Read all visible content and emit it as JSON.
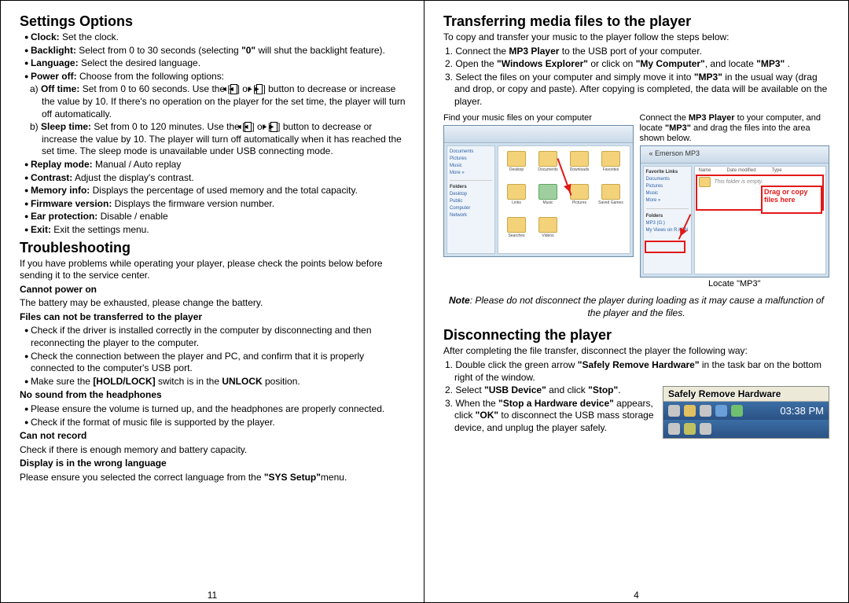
{
  "left": {
    "h_settings": "Settings Options",
    "clock": {
      "b": "Clock:",
      "t": " Set the clock."
    },
    "backlight": {
      "b": "Backlight:",
      "t1": " Select from 0 to 30 seconds (selecting ",
      "q0": "\"0\"",
      "t2": " will shut the backlight feature)."
    },
    "language": {
      "b": "Language:",
      "t": " Select the desired language."
    },
    "poweroff": {
      "b": "Power off:",
      "t": " Choose from the following options:"
    },
    "offtime": {
      "pre": "a) ",
      "b": "Off time:",
      "t1": " Set from 0 to 60 seconds.  Use the [",
      "t2": "] or [",
      "t3": "] button to decrease or increase the value by 10.  If there's no operation on the player for the set time, the player will turn off automatically."
    },
    "sleeptime": {
      "pre": "b) ",
      "b": "Sleep time:",
      "t1": " Set from 0 to 120 minutes. Use the [",
      "t2": "] or [",
      "t3": "] button to decrease or increase the value by 10. The player will turn off automatically when it has reached the set time. The sleep mode is unavailable under USB connecting mode."
    },
    "replay": {
      "b": "Replay mode:",
      "t": " Manual / Auto replay"
    },
    "contrast": {
      "b": "Contrast:",
      "t": " Adjust the display's contrast."
    },
    "memory": {
      "b": "Memory info:",
      "t": " Displays the percentage of used memory and the total capacity."
    },
    "fw": {
      "b": "Firmware version:",
      "t": " Displays the firmware version number."
    },
    "ear": {
      "b": "Ear protection:",
      "t": " Disable / enable"
    },
    "exit": {
      "b": "Exit:",
      "t": " Exit the settings menu."
    },
    "h_trouble": "Troubleshooting",
    "trouble_intro": "If you have problems while operating your player, please check the points below before sending it to the service center.",
    "t1_h": "Cannot power on",
    "t1_t": "The battery may be exhausted, please change the battery.",
    "t2_h": "Files can not be transferred to the player",
    "t2_b1": "Check if the driver is installed correctly in the computer by disconnecting and then reconnecting the player to the computer.",
    "t2_b2": "Check the connection between the player and PC, and confirm that it is properly connected to the computer's USB port.",
    "t2_b3a": "Make sure the ",
    "t2_b3b": "[HOLD/LOCK]",
    "t2_b3c": " switch is in the ",
    "t2_b3d": "UNLOCK",
    "t2_b3e": " position.",
    "t3_h": "No sound from the headphones",
    "t3_b1": "Please ensure the volume is turned up, and the headphones are properly connected.",
    "t3_b2": "Check if the format of music file is supported by the player.",
    "t4_h": "Can not record",
    "t4_t": "Check if there is enough memory and battery capacity.",
    "t5_h": "Display is in the wrong language",
    "t5_t1": "Please ensure you selected the correct language from the ",
    "t5_t2": "\"SYS Setup\"",
    "t5_t3": "menu.",
    "pagenum": "11"
  },
  "right": {
    "h_transfer": "Transferring media files to the player",
    "intro": "To copy and transfer your music to the player follow the steps below:",
    "s1a": "1. Connect the ",
    "s1b": "MP3 Player",
    "s1c": " to the USB port of your computer.",
    "s2a": "2. Open the ",
    "s2b": "\"Windows Explorer\"",
    "s2c": " or  click on ",
    "s2d": "\"My Computer\"",
    "s2e": ", and locate ",
    "s2f": "\"MP3\"",
    "s2g": " .",
    "s3a": "3. Select the files on your computer and simply move it into ",
    "s3b": "\"MP3\"",
    "s3c": " in the usual way (drag and drop, or copy and paste).  After copying is completed, the data will be available on the player.",
    "figL_cap": "Find your music files on your computer",
    "figR_cap1": "Connect the ",
    "figR_cap2": "MP3 Player",
    "figR_cap3": " to your computer, and locate ",
    "figR_cap4": "\"MP3\"",
    "figR_cap5": " and drag the files into the area shown below.",
    "drag_label": "Drag or copy files here",
    "win2_addr": "Emerson MP3",
    "locate_cap": "Locate \"MP3\"",
    "note1": "Note",
    "note2": ":  Please do not disconnect the player during loading as it may cause a malfunction of the player and the files.",
    "h_disc": "Disconnecting the player",
    "d_intro": "After completing the file transfer, disconnect the player the following way:",
    "d1a": "1. Double click the green arrow ",
    "d1b": "\"Safely Remove Hardware\"",
    "d1c": " in the task bar on the bottom right of the window.",
    "d2a": "2. Select ",
    "d2b": "\"USB Device\"",
    "d2c": " and click ",
    "d2d": "\"Stop\"",
    "d2e": ".",
    "d3a": "3. When the ",
    "d3b": "\"Stop a Hardware device\"",
    "d3c": " appears, click ",
    "d3d": "\"OK\"",
    "d3e": " to disconnect the USB mass storage device, and unplug the player  safely.",
    "tray_title": "Safely Remove Hardware",
    "tray_time": "03:38 PM",
    "pagenum": "4",
    "win2": {
      "hdr_name": "Name",
      "hdr_date": "Date modified",
      "hdr_type": "Type",
      "fav": "Favorite Links",
      "documents": "Documents",
      "pictures": "Pictures",
      "music": "Music",
      "more": "More »",
      "mp3g": "MP3 (G:)",
      "myviews": "My Views on R.KEN"
    }
  }
}
